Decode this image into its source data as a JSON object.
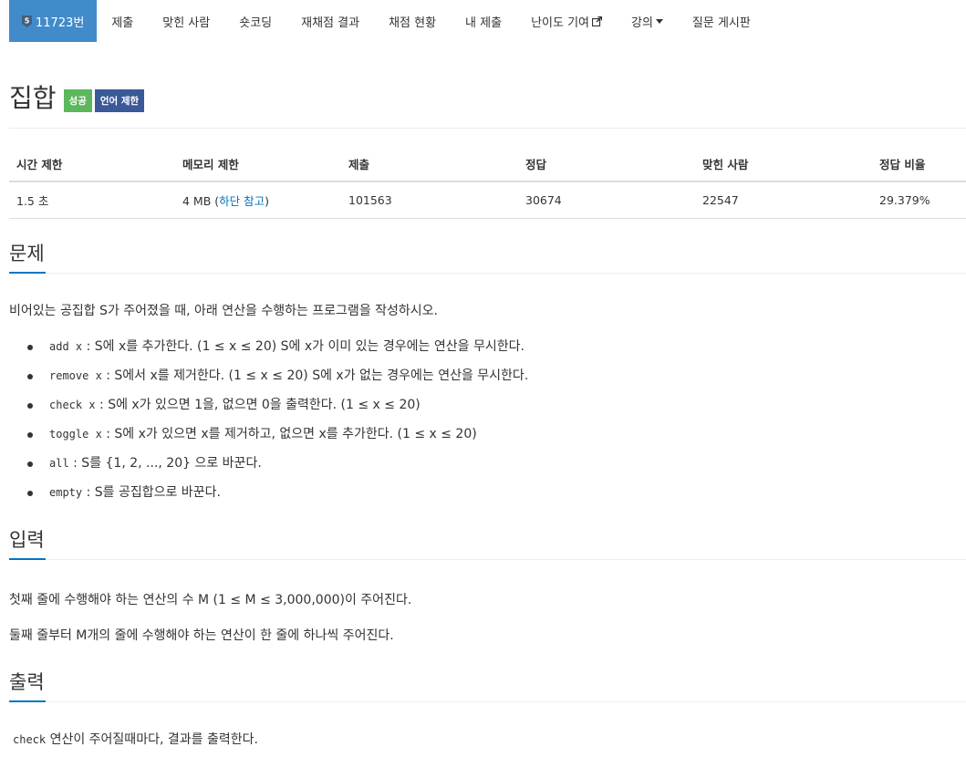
{
  "nav": {
    "problem_id": "11723번",
    "items": [
      "제출",
      "맞힌 사람",
      "숏코딩",
      "재채점 결과",
      "채점 현황",
      "내 제출",
      "난이도 기여",
      "강의",
      "질문 게시판"
    ],
    "tier_icon": "silver-5-tier-icon",
    "tier_color": "#435f7a",
    "active_color": "#428bca"
  },
  "title": {
    "text": "집합",
    "badge_success": "성공",
    "badge_lang": "언어 제한"
  },
  "info": {
    "headers": [
      "시간 제한",
      "메모리 제한",
      "제출",
      "정답",
      "맞힌 사람",
      "정답 비율"
    ],
    "time": "1.5 초",
    "memory_prefix": "4 MB (",
    "memory_link": "하단 참고",
    "memory_suffix": ")",
    "submissions": "101563",
    "accepted": "30674",
    "solvers": "22547",
    "ratio": "29.379%"
  },
  "problem": {
    "heading": "문제",
    "intro": "비어있는 공집합 S가 주어졌을 때, 아래 연산을 수행하는 프로그램을 작성하시오.",
    "ops": [
      {
        "code": "add x",
        "text": ": S에 x를 추가한다. (1 ≤ x ≤ 20) S에 x가 이미 있는 경우에는 연산을 무시한다."
      },
      {
        "code": "remove x",
        "text": ": S에서 x를 제거한다. (1 ≤ x ≤ 20) S에 x가 없는 경우에는 연산을 무시한다."
      },
      {
        "code": "check x",
        "text": ": S에 x가 있으면 1을, 없으면 0을 출력한다. (1 ≤ x ≤ 20)"
      },
      {
        "code": "toggle x",
        "text": ": S에 x가 있으면 x를 제거하고, 없으면 x를 추가한다. (1 ≤ x ≤ 20)"
      },
      {
        "code": "all",
        "text": ": S를 {1, 2, ..., 20} 으로 바꾼다."
      },
      {
        "code": "empty",
        "text": ": S를 공집합으로 바꾼다."
      }
    ]
  },
  "input": {
    "heading": "입력",
    "line1": "첫째 줄에 수행해야 하는 연산의 수 M (1 ≤ M ≤ 3,000,000)이 주어진다.",
    "line2": "둘째 줄부터 M개의 줄에 수행해야 하는 연산이 한 줄에 하나씩 주어진다."
  },
  "output": {
    "heading": "출력",
    "code": "check",
    "text": "연산이 주어질때마다, 결과를 출력한다."
  }
}
